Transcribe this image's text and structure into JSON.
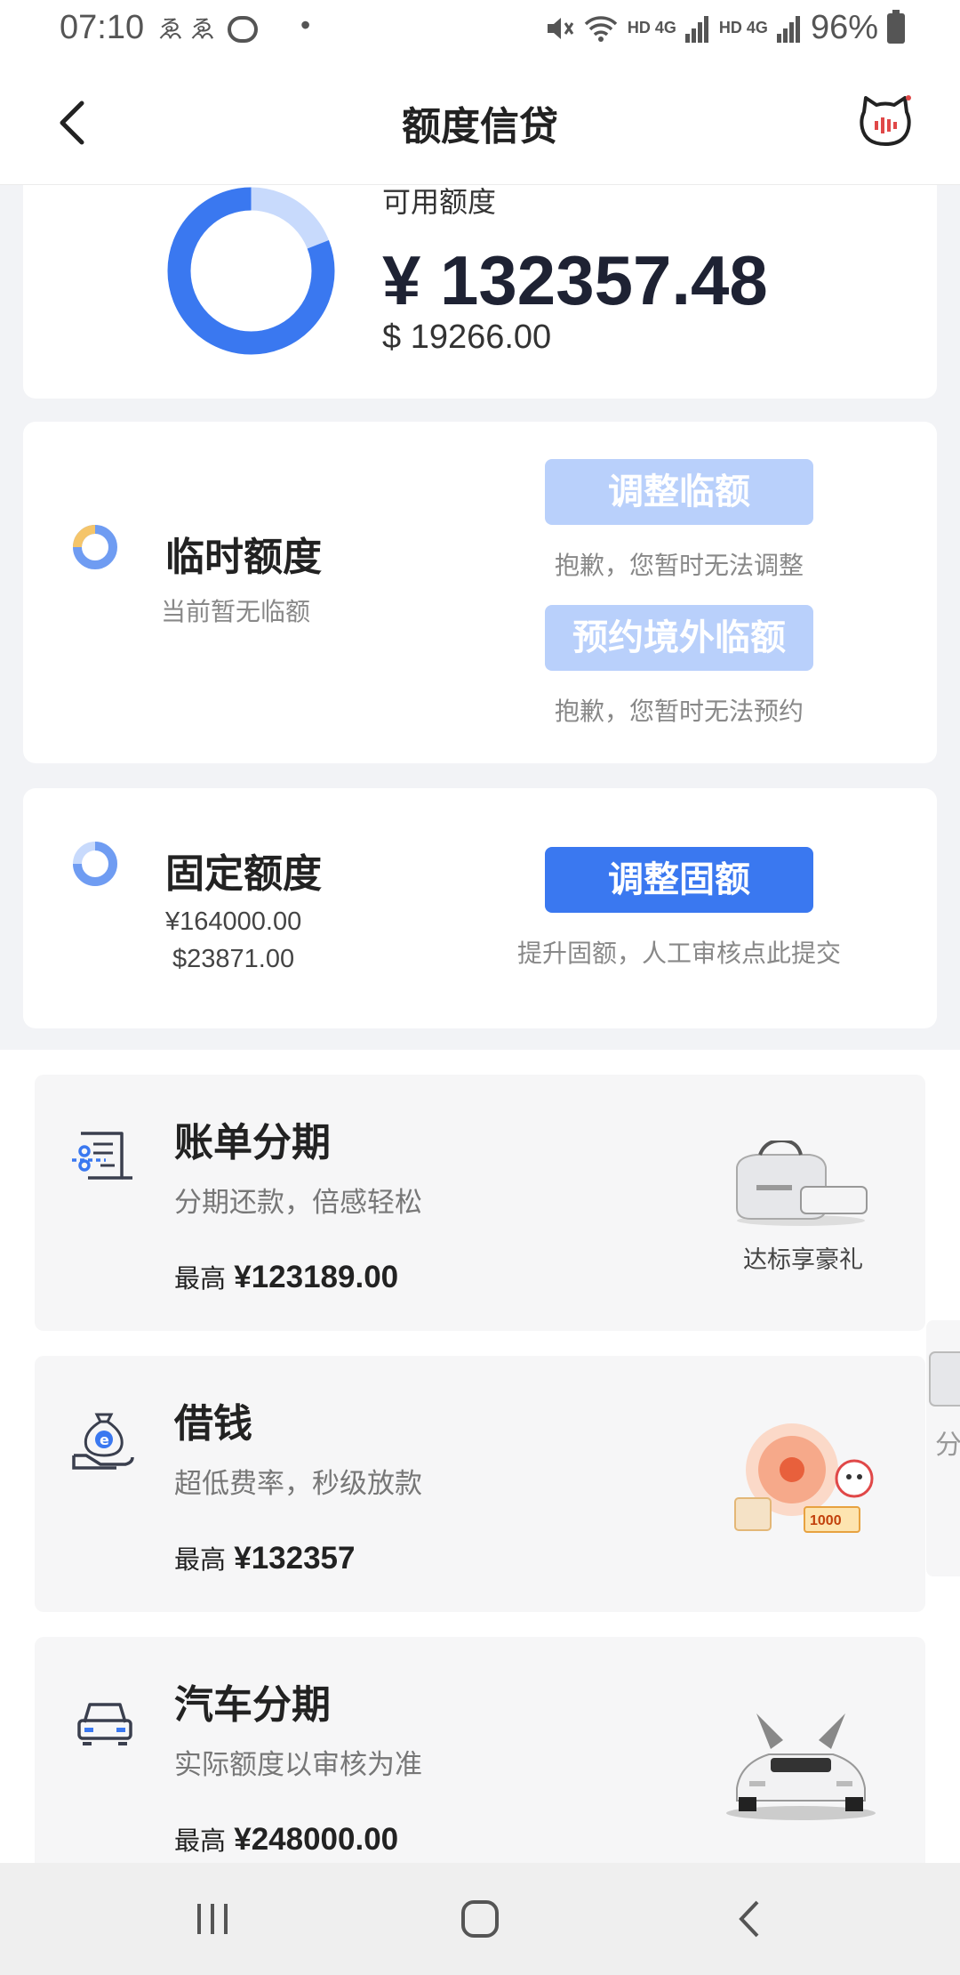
{
  "status_bar": {
    "time": "07:10",
    "notification_icons": "& & ☺ •",
    "battery": "96%",
    "signal_1": "HD 4G",
    "signal_2": "HD 4G"
  },
  "header": {
    "title": "额度信贷"
  },
  "summary": {
    "available_label": "可用额度",
    "available_cny": "¥ 132357.48",
    "available_usd": "$ 19266.00",
    "used_fraction": 0.19,
    "colors": {
      "primary": "#3a78f0",
      "light": "#c8dafc"
    }
  },
  "temporary": {
    "title": "临时额度",
    "subtitle": "当前暂无临额",
    "adjust_button": "调整临额",
    "adjust_note": "抱歉，您暂时无法调整",
    "reserve_button": "预约境外临额",
    "reserve_note": "抱歉，您暂时无法预约"
  },
  "fixed": {
    "title": "固定额度",
    "amount_cny": "¥164000.00",
    "amount_usd": "$23871.00",
    "adjust_button": "调整固额",
    "adjust_note": "提升固额，人工审核点此提交"
  },
  "products": [
    {
      "title": "账单分期",
      "subtitle": "分期还款，倍感轻松",
      "max_label": "最高",
      "max_value": "¥123189.00",
      "promo_label": "达标享豪礼",
      "icon": "bill-installment-icon"
    },
    {
      "title": "借钱",
      "subtitle": "超低费率，秒级放款",
      "max_label": "最高",
      "max_value": "¥132357",
      "promo_label": "",
      "icon": "money-bag-icon"
    },
    {
      "title": "汽车分期",
      "subtitle": "实际额度以审核为准",
      "max_label": "最高",
      "max_value": "¥248000.00",
      "promo_label": "",
      "icon": "car-icon"
    }
  ],
  "peek_label": "分"
}
